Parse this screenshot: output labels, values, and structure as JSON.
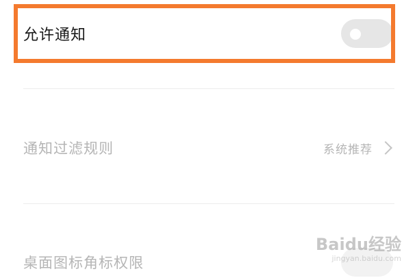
{
  "settings": {
    "allow_notifications": {
      "label": "允许通知",
      "enabled": false
    },
    "notification_filter": {
      "label": "通知过滤规则",
      "value": "系统推荐"
    },
    "desktop_badge": {
      "label": "桌面图标角标权限"
    }
  },
  "watermark": {
    "logo": "Baidu经验",
    "sub": "jingyan.baidu.com"
  },
  "colors": {
    "highlight": "#f47a2e",
    "toggle_off": "#e6e6e6",
    "disabled_text": "#b5b5b5"
  }
}
